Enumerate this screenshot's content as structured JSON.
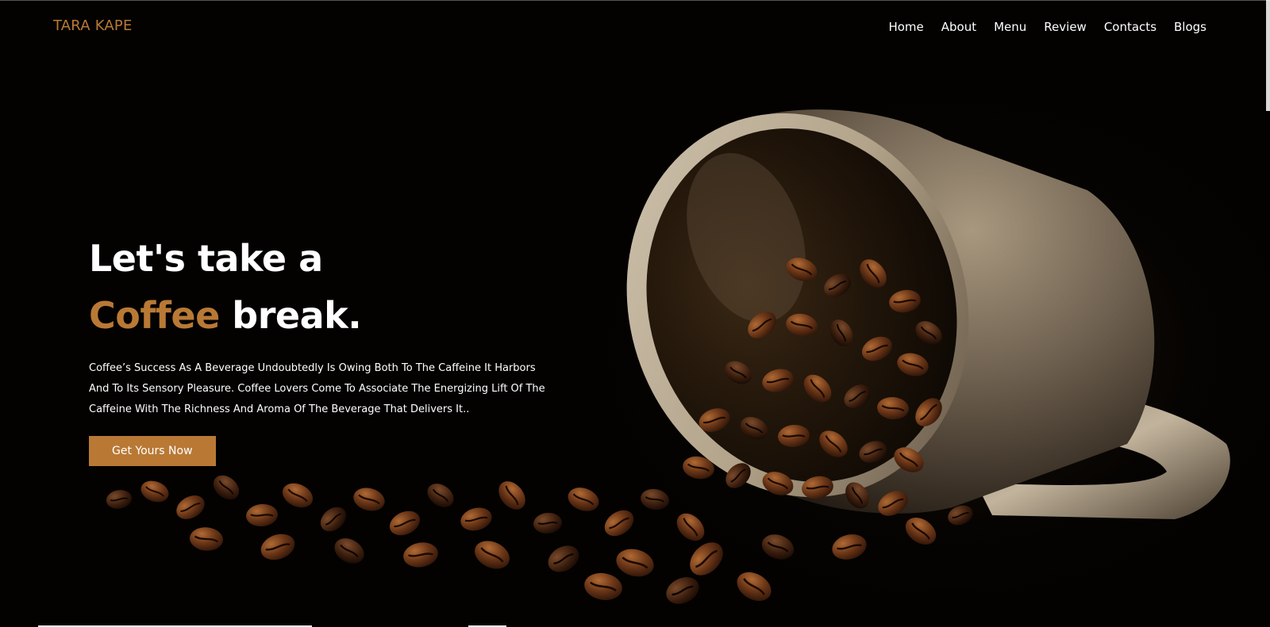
{
  "brand": {
    "logo": "TARA KAPE",
    "accent_color": "#b97935"
  },
  "nav": {
    "items": [
      {
        "label": "Home"
      },
      {
        "label": "About"
      },
      {
        "label": "Menu"
      },
      {
        "label": "Review"
      },
      {
        "label": "Contacts"
      },
      {
        "label": "Blogs"
      }
    ]
  },
  "hero": {
    "headline_line1": "Let's take a",
    "headline_accent": "Coffee",
    "headline_rest": " break.",
    "description": "Coffee’s Success As A Beverage Undoubtedly Is Owing Both To The Caffeine It Harbors And To Its Sensory Pleasure. Coffee Lovers Come To Associate The Energizing Lift Of The Caffeine With The Richness And Aroma Of The Beverage That Delivers It..",
    "cta_label": "Get Yours Now",
    "image_subject": "coffee-cup-with-spilled-beans"
  }
}
